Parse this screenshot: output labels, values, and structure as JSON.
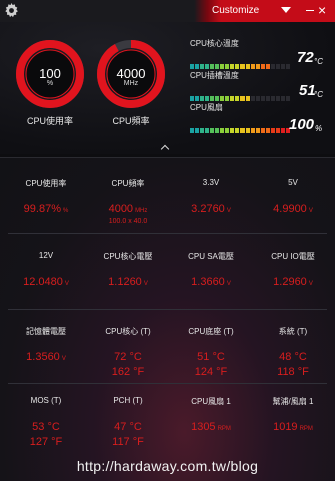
{
  "titlebar": {
    "preset": "Customize"
  },
  "gauges": [
    {
      "value": "100",
      "unit": "%",
      "caption": "CPU使用率",
      "fill": 1.0
    },
    {
      "value": "4000",
      "unit": "MHz",
      "caption": "CPU頻率",
      "fill": 0.92
    }
  ],
  "stats": [
    {
      "label": "CPU核心溫度",
      "value": "72",
      "unit": "°C",
      "level": 0.8
    },
    {
      "label": "CPU插槽溫度",
      "value": "51",
      "unit": "°C",
      "level": 0.62
    },
    {
      "label": "CPU風扇",
      "value": "100",
      "unit": "%",
      "level": 1.0
    }
  ],
  "bar_colors": [
    "#1aa3a3",
    "#2fb38a",
    "#55c05a",
    "#8ccf3a",
    "#c7d62a",
    "#e8c21e",
    "#f29a1a",
    "#f06a18",
    "#e83a18",
    "#e01e1e"
  ],
  "grid": [
    [
      {
        "label": "CPU使用率",
        "v1": "99.87%",
        "u1": "%"
      },
      {
        "label": "CPU頻率",
        "v1": "4000",
        "u1": "MHz",
        "sub": "100.0 x 40.0"
      },
      {
        "label": "3.3V",
        "v1": "3.2760",
        "u1": "V"
      },
      {
        "label": "5V",
        "v1": "4.9900",
        "u1": "V"
      }
    ],
    [
      {
        "label": "12V",
        "v1": "12.0480",
        "u1": "V"
      },
      {
        "label": "CPU核心電壓",
        "v1": "1.1260",
        "u1": "V"
      },
      {
        "label": "CPU SA電壓",
        "v1": "1.3660",
        "u1": "V"
      },
      {
        "label": "CPU IO電壓",
        "v1": "1.2960",
        "u1": "V"
      }
    ],
    [
      {
        "label": "記憶體電壓",
        "v1": "1.3560",
        "u1": "V"
      },
      {
        "label": "CPU核心 (T)",
        "v1": "72 °C",
        "v2": "162 °F"
      },
      {
        "label": "CPU底座 (T)",
        "v1": "51 °C",
        "v2": "124 °F"
      },
      {
        "label": "系統 (T)",
        "v1": "48 °C",
        "v2": "118 °F"
      }
    ],
    [
      {
        "label": "MOS (T)",
        "v1": "53 °C",
        "v2": "127 °F"
      },
      {
        "label": "PCH (T)",
        "v1": "47 °C",
        "v2": "117 °F"
      },
      {
        "label": "CPU風扇 1",
        "v1": "1305",
        "u1": "RPM"
      },
      {
        "label": "幫浦/風扇 1",
        "v1": "1019",
        "u1": "RPM"
      }
    ]
  ],
  "watermark": "http://hardaway.com.tw/blog"
}
